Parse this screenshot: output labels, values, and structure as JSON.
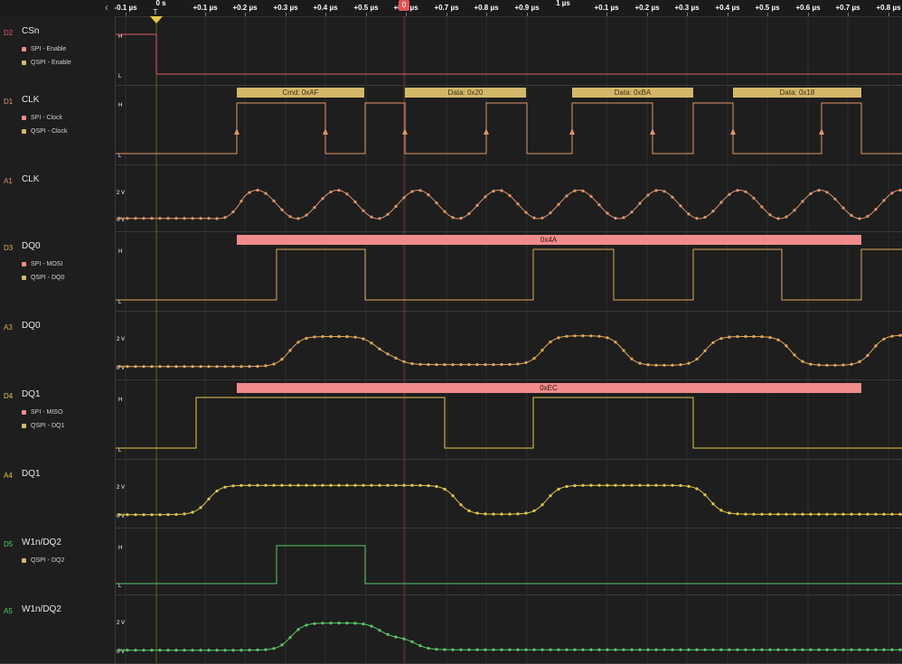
{
  "ruler": {
    "ticks": [
      "-0.1 µs",
      "+0.1 µs",
      "+0.2 µs",
      "+0.3 µs",
      "+0.4 µs",
      "+0.5 µs",
      "+0.6 µs",
      "+0.7 µs",
      "+0.8 µs",
      "+0.9 µs",
      "+0.1 µs",
      "+0.2 µs",
      "+0.3 µs",
      "+0.4 µs",
      "+0.5 µs",
      "+0.6 µs",
      "+0.7 µs",
      "+0.8 µs"
    ],
    "zero_label": "0 s",
    "major_label": "1 µs",
    "trigger_label": "T",
    "cursor_label": "0"
  },
  "channels": [
    {
      "id": "D2",
      "name": "CSn",
      "kind": "digital",
      "color": "#e05a6a",
      "protocols": [
        {
          "label": "SPI - Enable",
          "color": "#f08c8c"
        },
        {
          "label": "QSPI - Enable",
          "color": "#d4b86a"
        }
      ]
    },
    {
      "id": "D1",
      "name": "CLK",
      "kind": "digital",
      "color": "#e0956a",
      "protocols": [
        {
          "label": "SPI - Clock",
          "color": "#f08c8c"
        },
        {
          "label": "QSPI - Clock",
          "color": "#d4b86a"
        }
      ]
    },
    {
      "id": "A1",
      "name": "CLK",
      "kind": "analog",
      "color": "#e0956a",
      "protocols": []
    },
    {
      "id": "D3",
      "name": "DQ0",
      "kind": "digital",
      "color": "#e0a85a",
      "protocols": [
        {
          "label": "SPI - MOSI",
          "color": "#f08c8c"
        },
        {
          "label": "QSPI - DQ0",
          "color": "#d4b86a"
        }
      ]
    },
    {
      "id": "A3",
      "name": "DQ0",
      "kind": "analog",
      "color": "#e0a85a",
      "protocols": []
    },
    {
      "id": "D4",
      "name": "DQ1",
      "kind": "digital",
      "color": "#e0c84a",
      "protocols": [
        {
          "label": "SPI - MISO",
          "color": "#f08c8c"
        },
        {
          "label": "QSPI - DQ1",
          "color": "#d4b86a"
        }
      ]
    },
    {
      "id": "A4",
      "name": "DQ1",
      "kind": "analog",
      "color": "#e0c84a",
      "protocols": []
    },
    {
      "id": "D5",
      "name": "W1n/DQ2",
      "kind": "digital",
      "color": "#5ac86a",
      "protocols": [
        {
          "label": "QSPI - DQ2",
          "color": "#d4b86a"
        }
      ]
    },
    {
      "id": "A5",
      "name": "W1n/DQ2",
      "kind": "analog",
      "color": "#5ac86a",
      "protocols": []
    }
  ],
  "levels": {
    "high": "H",
    "low": "L",
    "v2": "2 V",
    "v0": "0 V"
  },
  "annotations": {
    "clk": [
      "Cmd: 0xAF",
      "Data: 0x20",
      "Data: 0xBA",
      "Data: 0x18"
    ],
    "mosi": "0x4A",
    "miso": "0xEC"
  },
  "colors": {
    "qspi_annotation": "#d4b86a",
    "spi_annotation": "#f08c8c",
    "cursor": "#e05555",
    "trigger": "#e6c84a"
  },
  "icons": {
    "nav_left": "chevron-left-icon",
    "trigger": "trigger-icon"
  }
}
